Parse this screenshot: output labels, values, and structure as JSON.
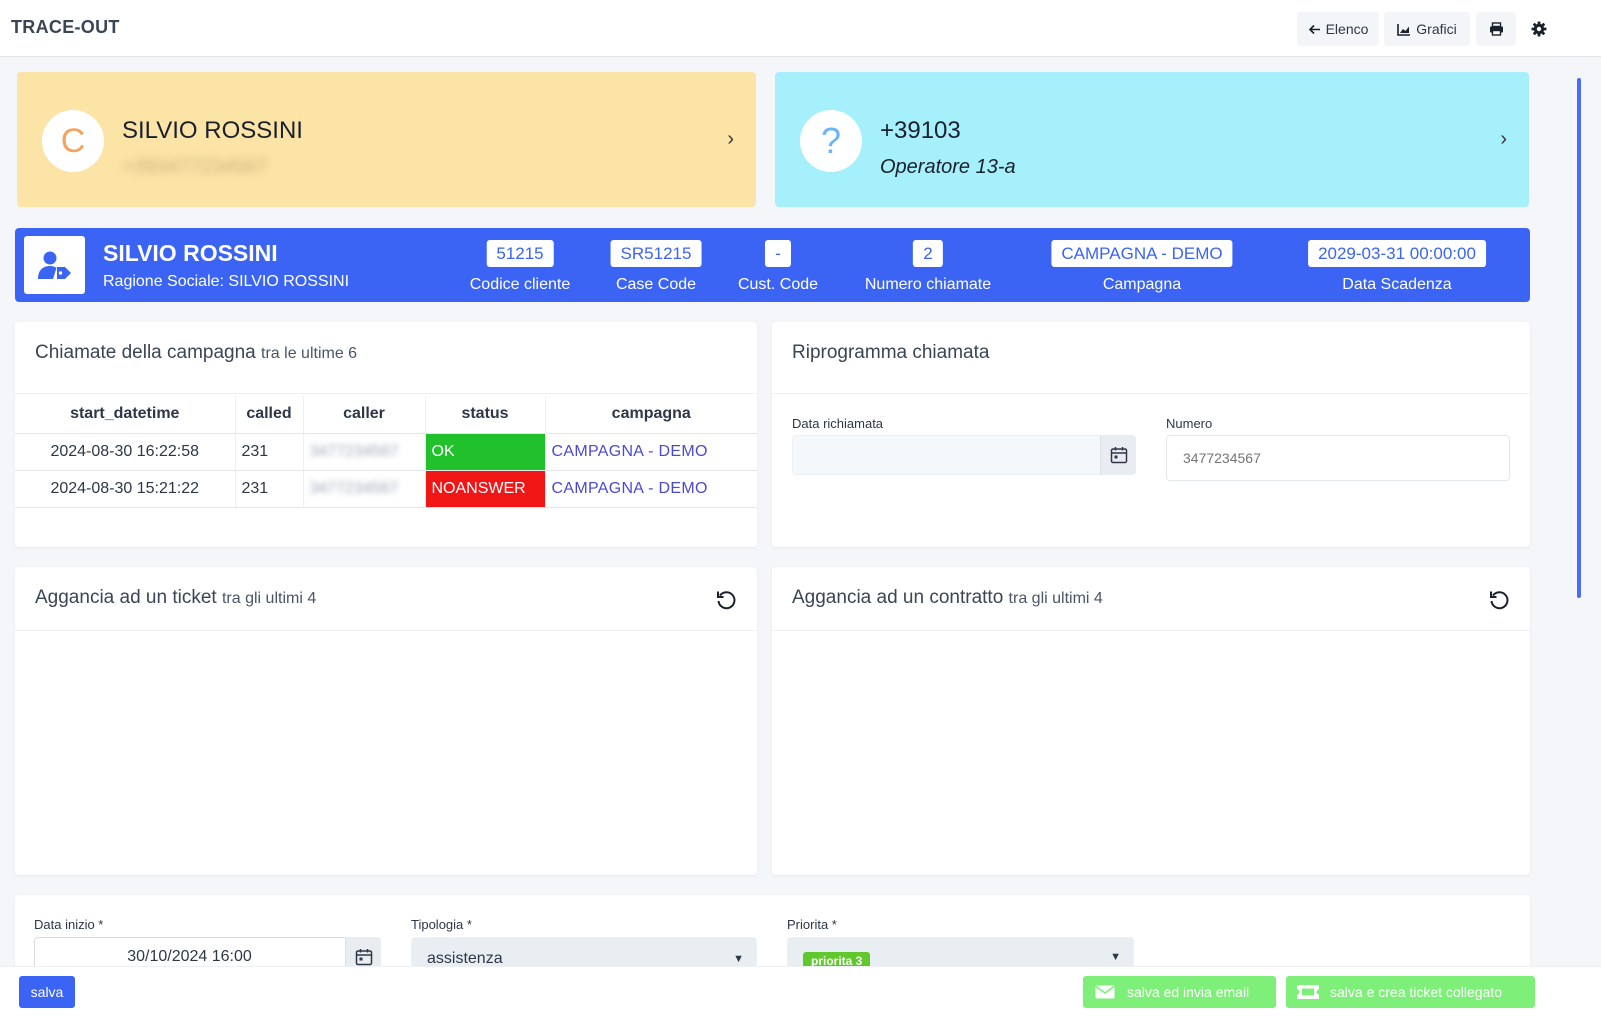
{
  "app": {
    "title": "TRACE-OUT"
  },
  "toolbar": {
    "elenco": "Elenco",
    "grafici": "Grafici"
  },
  "contact_cards": [
    {
      "initial": "C",
      "name": "SILVIO ROSSINI",
      "phone": "+393477234567",
      "bg": "#fbe4a6",
      "accent": "#f5a25d"
    },
    {
      "initial": "?",
      "name": "+39103",
      "operator": "Operatore 13-a",
      "bg": "#a6f0fc",
      "accent": "#6ab6f5"
    }
  ],
  "customer": {
    "name": "SILVIO ROSSINI",
    "ragione_sociale": "Ragione Sociale: SILVIO ROSSINI",
    "fields": [
      {
        "value": "51215",
        "label": "Codice cliente"
      },
      {
        "value": "SR51215",
        "label": "Case Code"
      },
      {
        "value": "-",
        "label": "Cust. Code"
      },
      {
        "value": "2",
        "label": "Numero chiamate"
      },
      {
        "value": "CAMPAGNA - DEMO",
        "label": "Campagna"
      },
      {
        "value": "2029-03-31 00:00:00",
        "label": "Data Scadenza"
      }
    ]
  },
  "calls": {
    "title": "Chiamate della campagna",
    "subtitle": "tra le ultime 6",
    "columns": [
      "start_datetime",
      "called",
      "caller",
      "status",
      "campagna"
    ],
    "rows": [
      {
        "start_datetime": "2024-08-30 16:22:58",
        "called": "231",
        "caller": "3477234567",
        "status": "OK",
        "campagna": "CAMPAGNA - DEMO"
      },
      {
        "start_datetime": "2024-08-30 15:21:22",
        "called": "231",
        "caller": "3477234567",
        "status": "NOANSWER",
        "campagna": "CAMPAGNA - DEMO"
      }
    ]
  },
  "reschedule": {
    "title": "Riprogramma chiamata",
    "date_label": "Data richiamata",
    "date_value": "",
    "number_label": "Numero",
    "number_placeholder": "3477234567"
  },
  "ticket": {
    "title": "Aggancia ad un ticket",
    "subtitle": "tra gli ultimi 4"
  },
  "contract": {
    "title": "Aggancia ad un contratto",
    "subtitle": "tra gli ultimi 4"
  },
  "form": {
    "data_inizio_label": "Data inizio *",
    "data_inizio_value": "30/10/2024 16:00",
    "tipologia_label": "Tipologia *",
    "tipologia_value": "assistenza",
    "priorita_label": "Priorita *",
    "priorita_value": "priorita 3"
  },
  "actions": {
    "salva": "salva",
    "salva_email": "salva ed invia email",
    "salva_ticket": "salva e crea ticket collegato"
  },
  "colors": {
    "primary": "#3b64f5",
    "ok": "#21c12c",
    "noanswer": "#f01616",
    "green_btn": "#7ef07a"
  }
}
